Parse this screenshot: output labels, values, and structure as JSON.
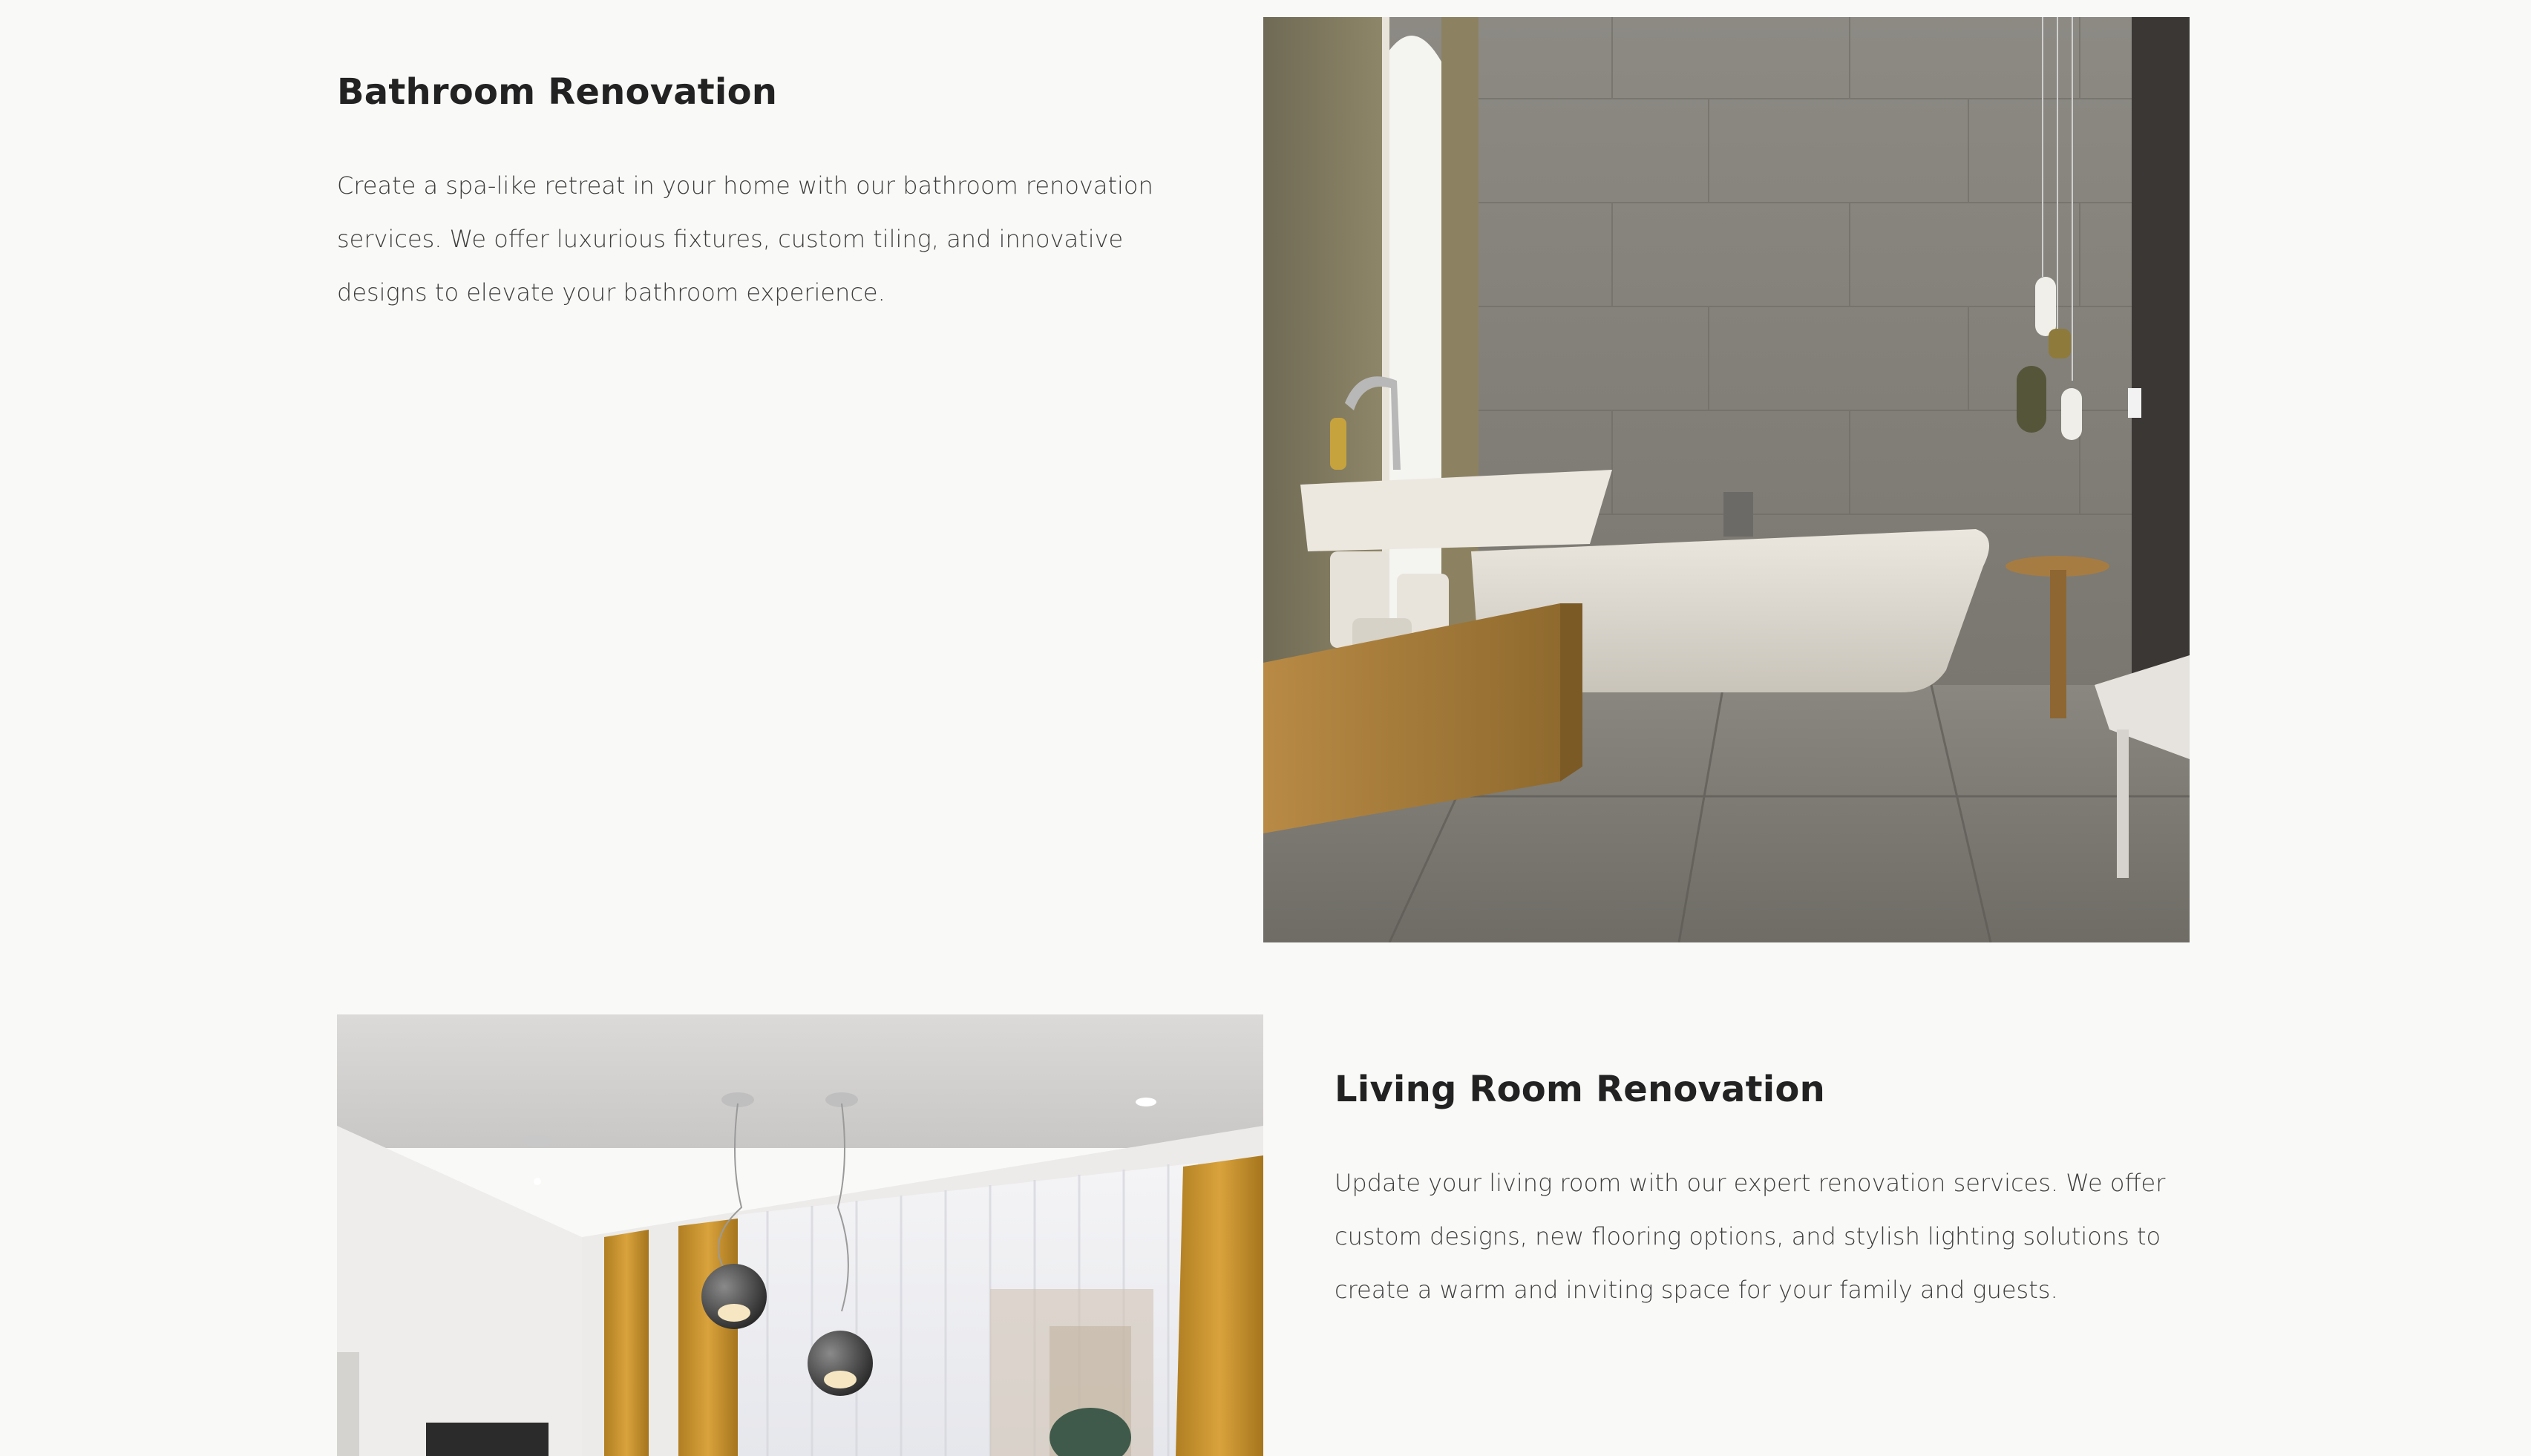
{
  "sections": {
    "bathroom": {
      "title": "Bathroom Renovation",
      "description": "Create a spa-like retreat in your home with our bathroom renovation services. We offer luxurious fixtures, custom tiling, and innovative designs to elevate your bathroom experience."
    },
    "living_room": {
      "title": "Living Room Renovation",
      "description": "Update your living room with our expert renovation services. We offer custom designs, new flooring options, and stylish lighting solutions to create a warm and inviting space for your family and guests."
    }
  },
  "colors": {
    "background": "#f9f9f7",
    "heading": "#222222",
    "body_text": "#3e3e3e",
    "curtain_gold": "#c8952e",
    "tile_gray": "#8a8780",
    "wood": "#a67c3a"
  }
}
